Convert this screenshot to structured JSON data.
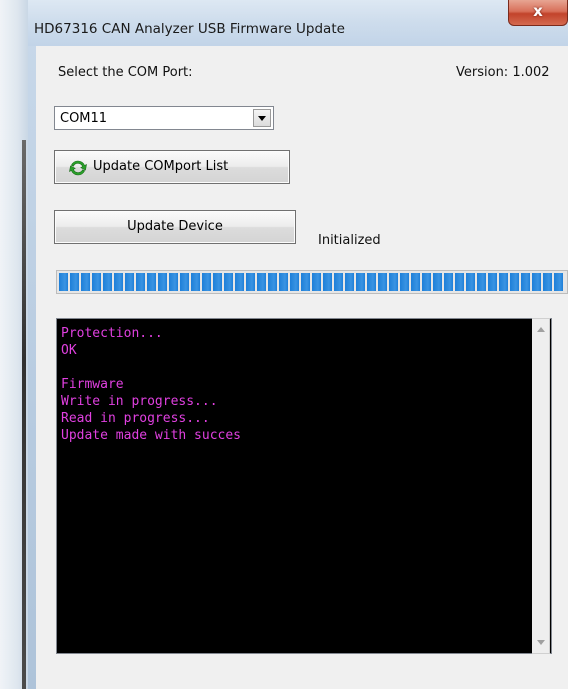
{
  "window": {
    "title": "HD67316 CAN Analyzer USB Firmware Update",
    "close_glyph": "x"
  },
  "port": {
    "label": "Select the COM Port:",
    "selected": "COM11"
  },
  "version_text": "Version: 1.002",
  "buttons": {
    "update_list": "Update COMport List",
    "update_device": "Update Device"
  },
  "status_text": "Initialized",
  "progress": {
    "percent": 100,
    "color": "#1e7fd8"
  },
  "console": {
    "text_color": "#e040e0",
    "background": "#000000",
    "lines": [
      "Protection...",
      "OK",
      "",
      "Firmware",
      "Write in progress...",
      "Read in progress...",
      "Update made with succes"
    ]
  },
  "icons": {
    "refresh": "refresh-icon",
    "dropdown": "chevron-down-icon",
    "scroll_up": "scroll-up-arrow-icon",
    "scroll_down": "scroll-down-arrow-icon",
    "close": "close-icon"
  }
}
